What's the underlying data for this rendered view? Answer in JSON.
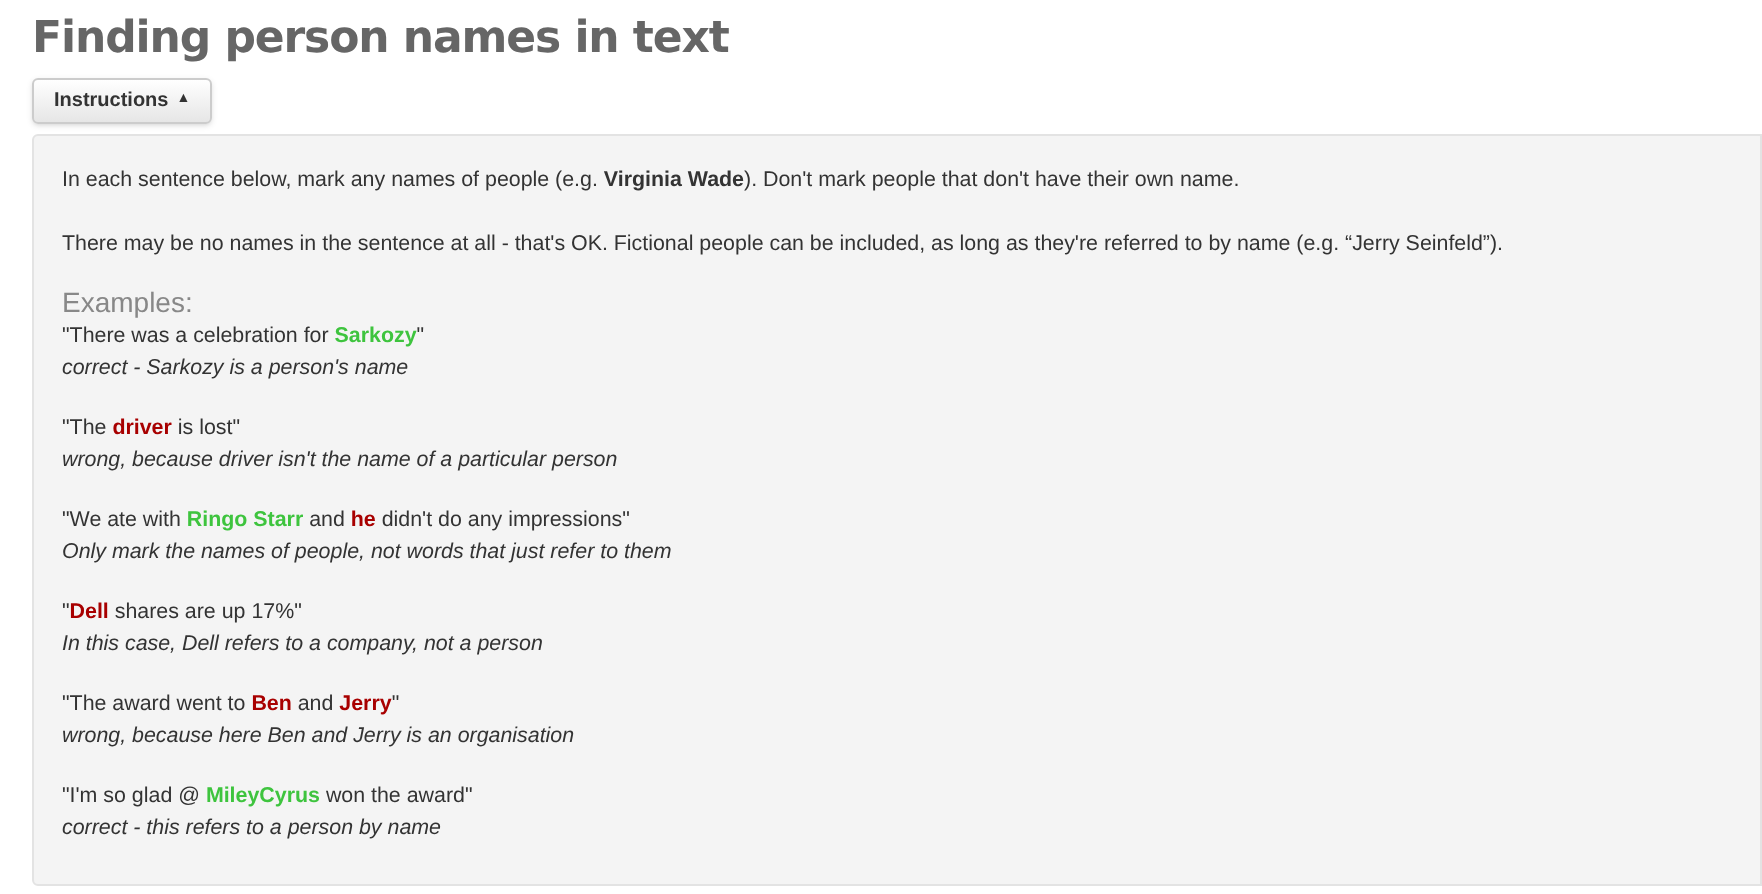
{
  "title": "Finding person names in text",
  "instructions_button": {
    "label": "Instructions",
    "caret": "▲",
    "expanded": true
  },
  "paragraphs": [
    "In each sentence below, mark any names of people (e.g. **Virginia Wade**). Don't mark people that don't have their own name.",
    "There may be no names in the sentence at all - that's OK. Fictional people can be included, as long as they're referred to by name (e.g. “Jerry Seinfeld”)."
  ],
  "examples_heading": "Examples:",
  "examples": [
    {
      "sentence": [
        {
          "text": "\"There was a celebration for ",
          "kind": "plain"
        },
        {
          "text": "Sarkozy",
          "kind": "correct"
        },
        {
          "text": "\"",
          "kind": "plain"
        }
      ],
      "note": "correct - Sarkozy is a person's name"
    },
    {
      "sentence": [
        {
          "text": "\"The ",
          "kind": "plain"
        },
        {
          "text": "driver",
          "kind": "wrong"
        },
        {
          "text": " is lost\"",
          "kind": "plain"
        }
      ],
      "note": "wrong, because driver isn't the name of a particular person"
    },
    {
      "sentence": [
        {
          "text": "\"We ate with ",
          "kind": "plain"
        },
        {
          "text": "Ringo Starr",
          "kind": "correct"
        },
        {
          "text": " and ",
          "kind": "plain"
        },
        {
          "text": "he",
          "kind": "wrong"
        },
        {
          "text": " didn't do any impressions\"",
          "kind": "plain"
        }
      ],
      "note": "Only mark the names of people, not words that just refer to them"
    },
    {
      "sentence": [
        {
          "text": "\"",
          "kind": "plain"
        },
        {
          "text": "Dell",
          "kind": "wrong"
        },
        {
          "text": " shares are up 17%\"",
          "kind": "plain"
        }
      ],
      "note": "In this case, Dell refers to a company, not a person"
    },
    {
      "sentence": [
        {
          "text": "\"The award went to ",
          "kind": "plain"
        },
        {
          "text": "Ben",
          "kind": "wrong"
        },
        {
          "text": " and ",
          "kind": "plain"
        },
        {
          "text": "Jerry",
          "kind": "wrong"
        },
        {
          "text": "\"",
          "kind": "plain"
        }
      ],
      "note": "wrong, because here Ben and Jerry is an organisation"
    },
    {
      "sentence": [
        {
          "text": "\"I'm so glad @ ",
          "kind": "plain"
        },
        {
          "text": "MileyCyrus",
          "kind": "correct"
        },
        {
          "text": " won the award\"",
          "kind": "plain"
        }
      ],
      "note": "correct - this refers to a person by name"
    }
  ]
}
